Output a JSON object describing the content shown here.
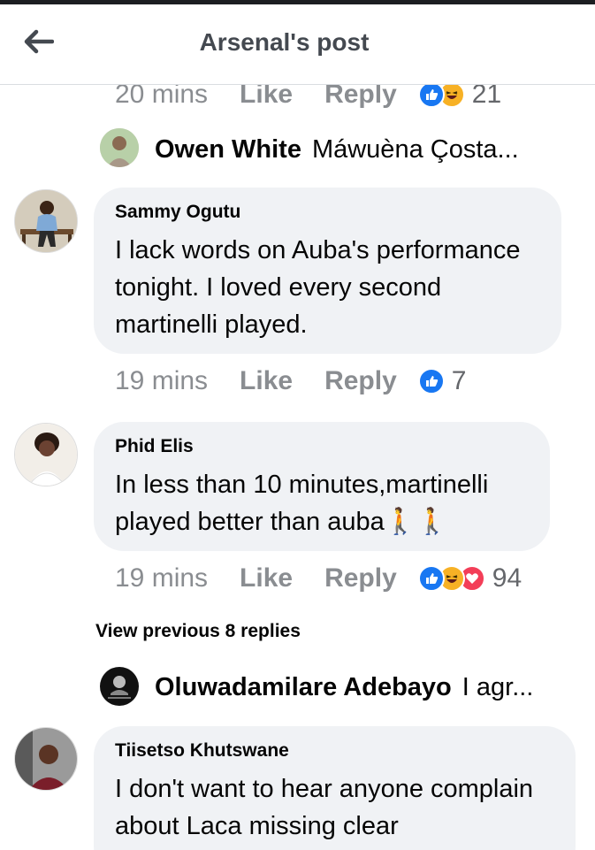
{
  "header": {
    "title": "Arsenal's post",
    "back_icon": "arrow-left-icon"
  },
  "reactions": {
    "like_color": "#1877f2",
    "haha_color": "#f7b125",
    "love_color": "#f33e58"
  },
  "top_comment_meta": {
    "time": "20 mins",
    "like": "Like",
    "reply": "Reply",
    "count": "21"
  },
  "reply_preview_1": {
    "name": "Owen White",
    "text": "Máwuèna Çosta..."
  },
  "comments": [
    {
      "author": "Sammy Ogutu",
      "text": "I lack words on Auba's performance tonight. I loved every second martinelli played.",
      "time": "19 mins",
      "like": "Like",
      "reply": "Reply",
      "count": "7"
    },
    {
      "author": "Phid Elis",
      "text": "In less than 10 minutes,martinelli played better than auba🚶🚶",
      "time": "19 mins",
      "like": "Like",
      "reply": "Reply",
      "count": "94"
    },
    {
      "author": "Tiisetso Khutswane",
      "text": "I don't want to hear anyone complain about Laca missing clear"
    }
  ],
  "view_previous": "View previous 8 replies",
  "reply_preview_2": {
    "name": "Oluwadamilare Adebayo",
    "text": "I agr..."
  }
}
